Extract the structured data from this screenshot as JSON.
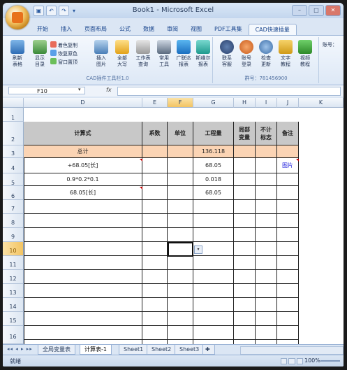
{
  "window": {
    "title": "Book1 - Microsoft Excel"
  },
  "quick_access": [
    "save",
    "undo",
    "redo"
  ],
  "ribbon": {
    "tabs": [
      "开始",
      "插入",
      "页面布局",
      "公式",
      "数据",
      "审阅",
      "视图",
      "PDF工具集",
      "CAD快速插量"
    ],
    "active_tab": "CAD快速插量",
    "group1": {
      "label": "CAD插件工具栏1.0",
      "buttons": [
        {
          "label": "刷新\n表格",
          "icon": "refresh-table-icon"
        },
        {
          "label": "显示\n目录",
          "icon": "show-directory-icon"
        },
        {
          "label": "插入\n图片",
          "icon": "insert-image-icon"
        },
        {
          "label": "全部\n大写",
          "icon": "uppercase-icon"
        },
        {
          "label": "工作表\n查询",
          "icon": "sheet-query-icon"
        },
        {
          "label": "常用\n工具",
          "icon": "toolbox-icon"
        },
        {
          "label": "广联达\n报表",
          "icon": "glodon-report-icon"
        },
        {
          "label": "斯维尔\n报表",
          "icon": "thsware-report-icon"
        }
      ],
      "small": [
        "着色复制",
        "恢复原色",
        "窗口置顶"
      ]
    },
    "group2": {
      "label": "群号：781456900",
      "buttons": [
        {
          "label": "联系\n客服",
          "icon": "contact-service-icon"
        },
        {
          "label": "账号\n登录",
          "icon": "account-login-icon"
        },
        {
          "label": "检查\n更新",
          "icon": "check-update-icon"
        },
        {
          "label": "文字\n教程",
          "icon": "text-tutorial-icon"
        },
        {
          "label": "视频\n教程",
          "icon": "video-tutorial-icon"
        }
      ],
      "side": "账号："
    }
  },
  "formula_bar": {
    "name_box": "F10",
    "fx": "fx",
    "value": ""
  },
  "columns": [
    "D",
    "E",
    "F",
    "G",
    "H",
    "I",
    "J",
    "K"
  ],
  "selected_column": "F",
  "rows": [
    "1",
    "2",
    "3",
    "4",
    "5",
    "6",
    "7",
    "8",
    "9",
    "10",
    "11",
    "12",
    "13",
    "14",
    "15",
    "16"
  ],
  "selected_row": "10",
  "table": {
    "headers": {
      "D": "计算式",
      "E": "系数",
      "F": "单位",
      "G": "工程量",
      "H": "局部\n变量",
      "I": "不计\n标志",
      "J": "备注"
    },
    "rows": [
      {
        "D": "总计",
        "G": "136.118"
      },
      {
        "D": "+68.05[长]",
        "G": "68.05",
        "J": "图片"
      },
      {
        "D": "0.9*0.2*0.1",
        "G": "0.018"
      },
      {
        "D": "68.05[长]",
        "G": "68.05"
      }
    ]
  },
  "sheet_tabs": [
    "全局变量表",
    "计算表-1",
    "Sheet1",
    "Sheet2",
    "Sheet3"
  ],
  "active_sheet": "计算表-1",
  "status": {
    "ready": "就绪",
    "zoom": "100%"
  },
  "colors": {
    "header_fill": "#c8c8c8",
    "total_fill": "#fbd4b4",
    "link": "#1a1adb",
    "accent": "#e8711c"
  }
}
